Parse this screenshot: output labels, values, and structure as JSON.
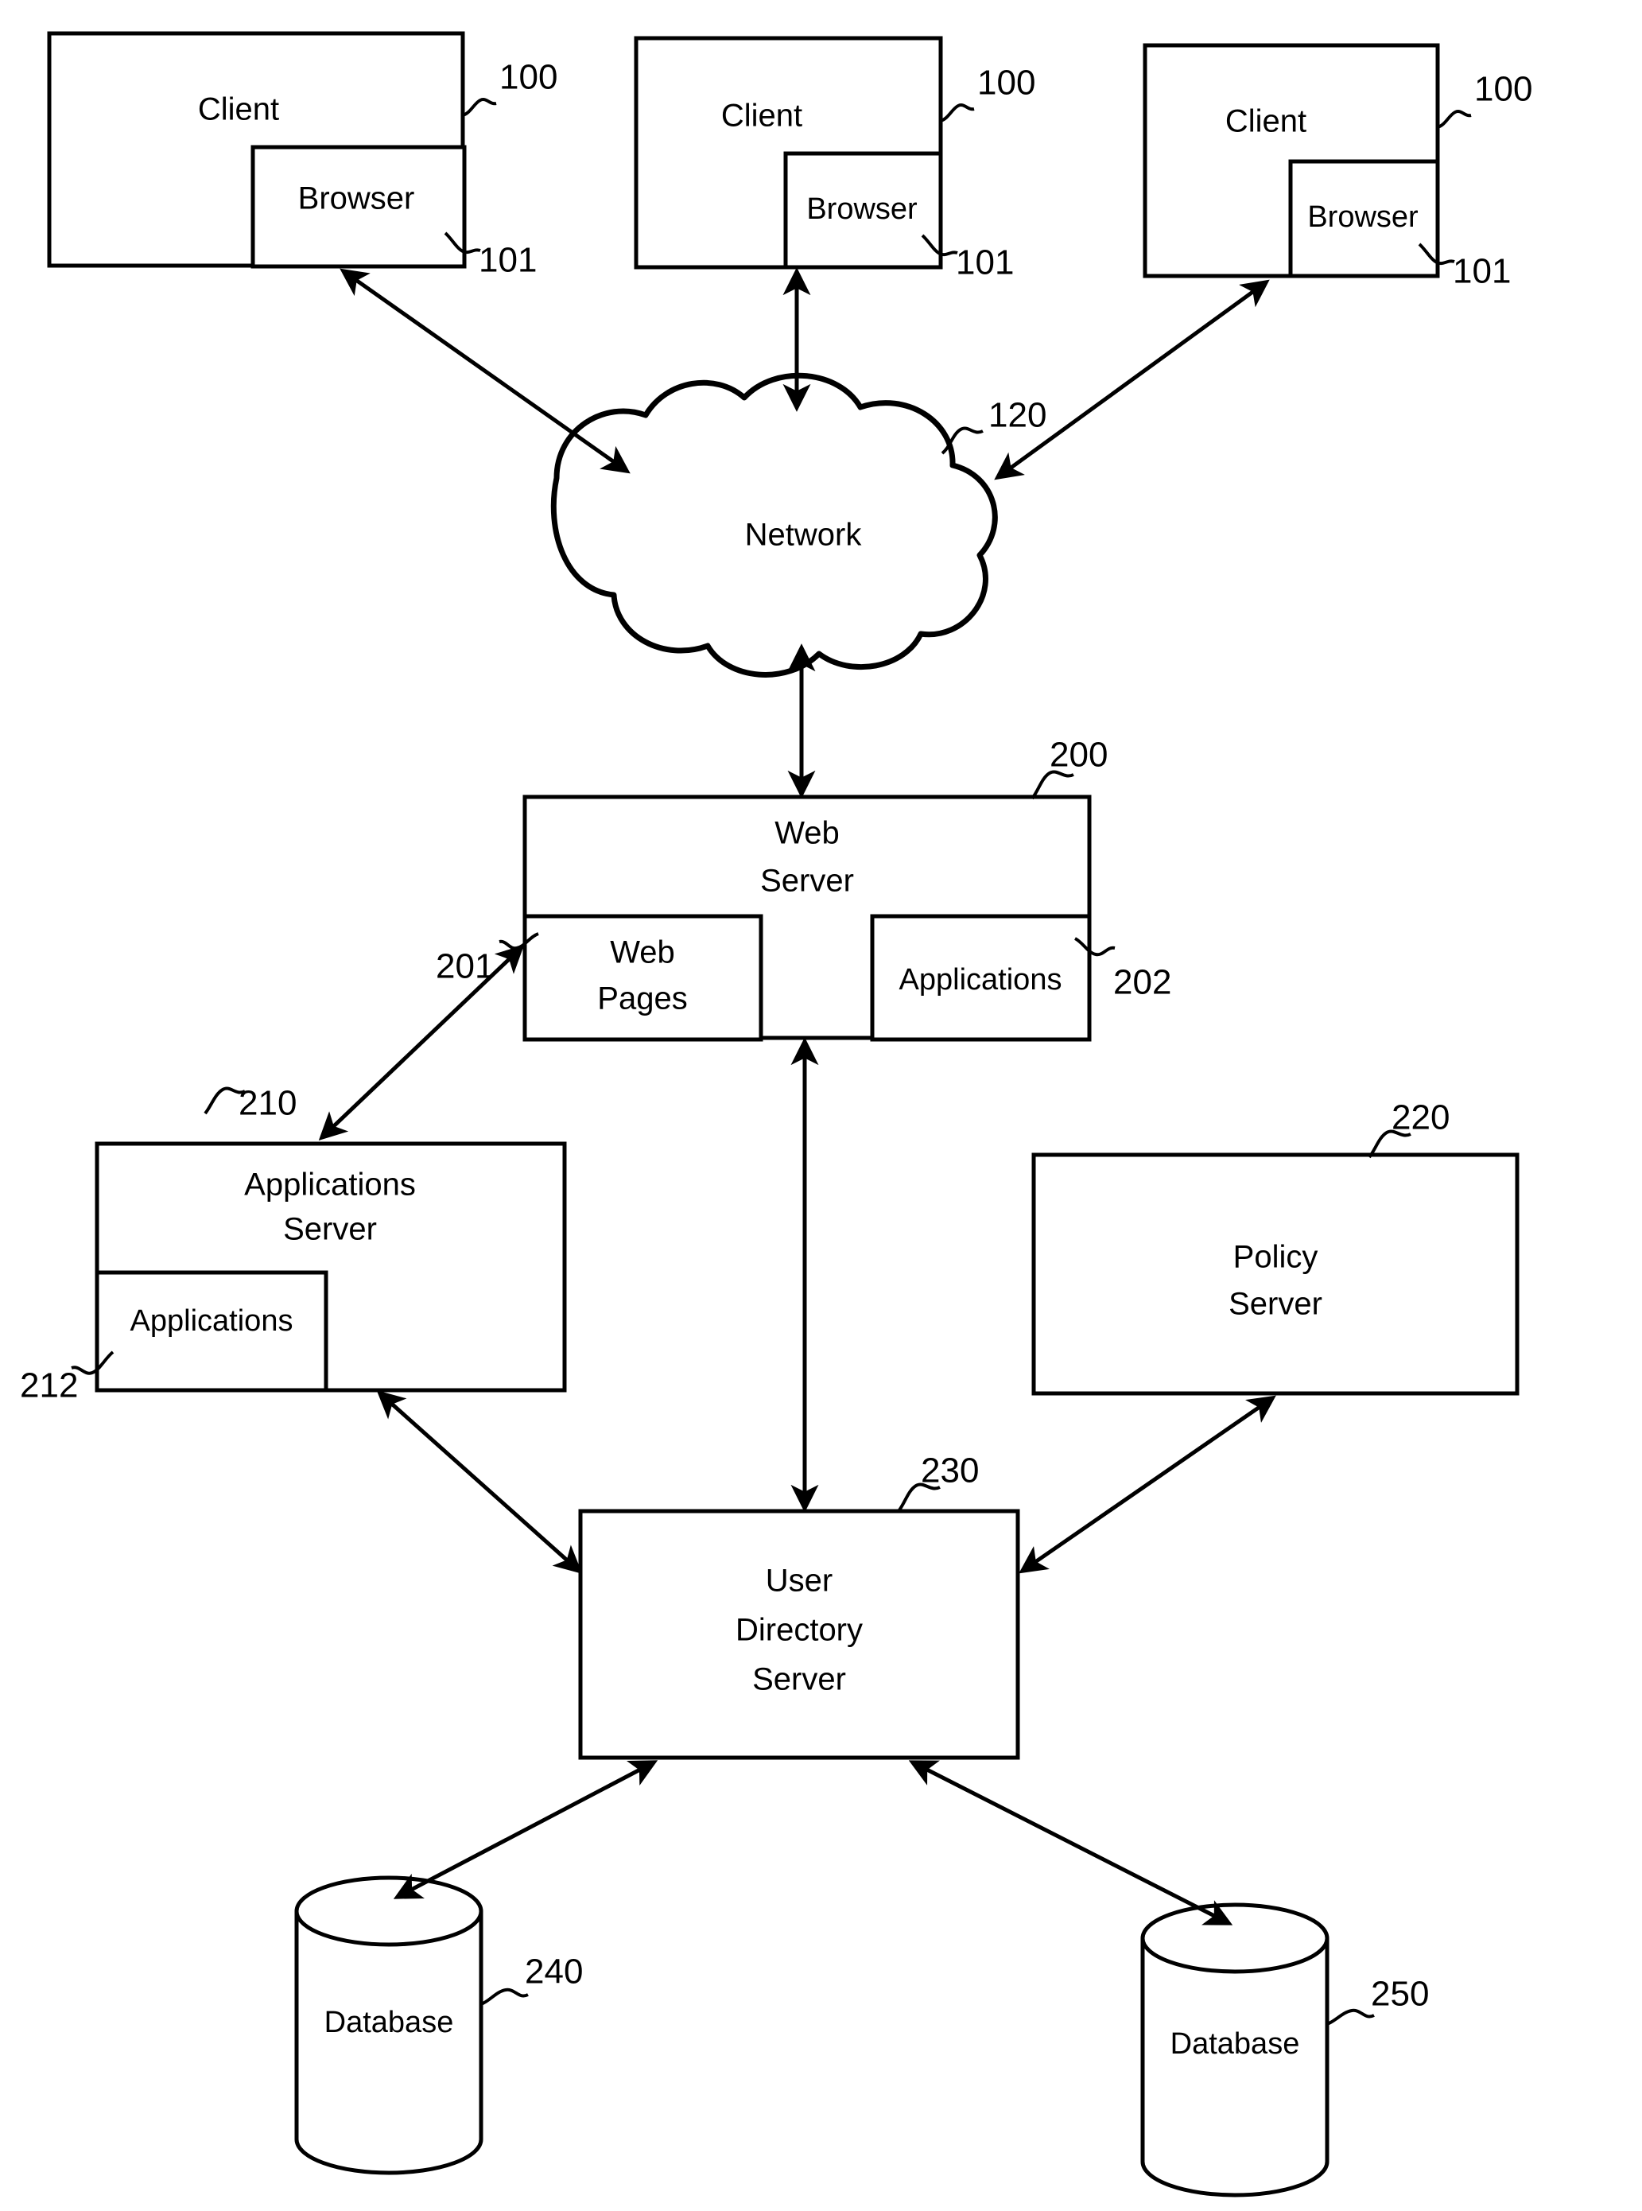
{
  "figure": {
    "type": "patent-architecture-diagram",
    "background_color": "#ffffff",
    "line_color": "#000000"
  },
  "clients": [
    {
      "label": "Client",
      "ref": "100",
      "browser_label": "Browser",
      "browser_ref": "101"
    },
    {
      "label": "Client",
      "ref": "100",
      "browser_label": "Browser",
      "browser_ref": "101"
    },
    {
      "label": "Client",
      "ref": "100",
      "browser_label": "Browser",
      "browser_ref": "101"
    }
  ],
  "network": {
    "label": "Network",
    "ref": "120"
  },
  "web_server": {
    "label_line1": "Web",
    "label_line2": "Server",
    "ref": "200",
    "web_pages": {
      "label_line1": "Web",
      "label_line2": "Pages",
      "ref": "201"
    },
    "applications": {
      "label": "Applications",
      "ref": "202"
    }
  },
  "applications_server": {
    "label_line1": "Applications",
    "label_line2": "Server",
    "ref": "210",
    "applications": {
      "label": "Applications",
      "ref": "212"
    }
  },
  "policy_server": {
    "label_line1": "Policy",
    "label_line2": "Server",
    "ref": "220"
  },
  "user_directory_server": {
    "label_line1": "User",
    "label_line2": "Directory",
    "label_line3": "Server",
    "ref": "230"
  },
  "databases": [
    {
      "label": "Database",
      "ref": "240"
    },
    {
      "label": "Database",
      "ref": "250"
    }
  ]
}
